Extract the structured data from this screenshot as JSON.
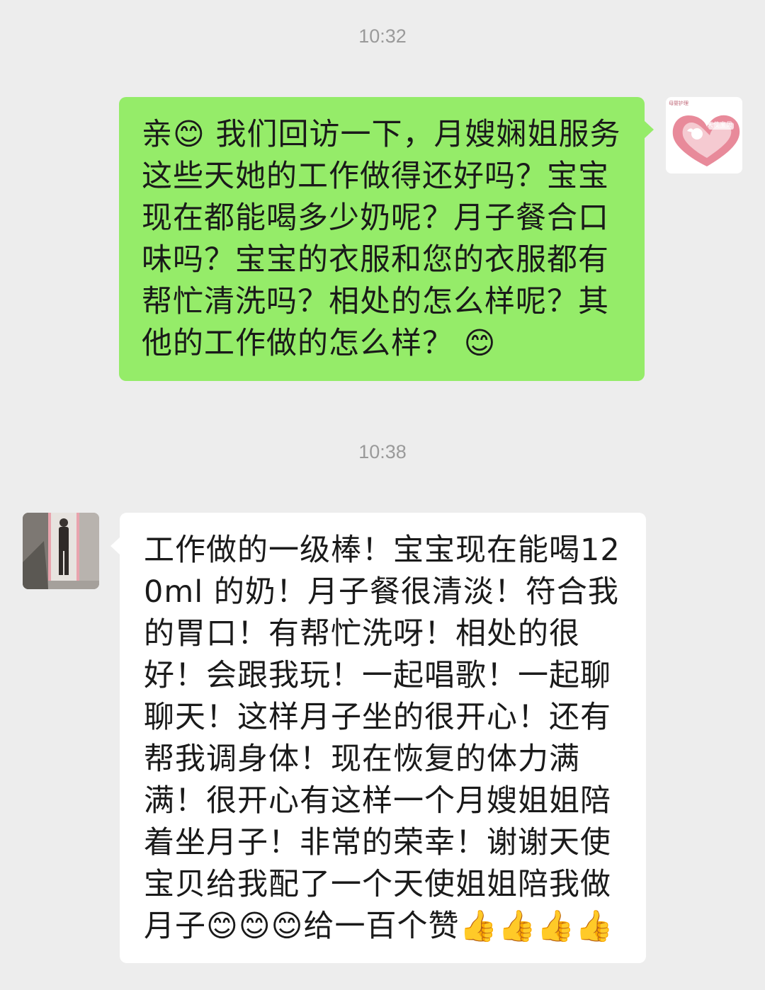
{
  "chat": {
    "timestamp_1": "10:32",
    "timestamp_2": "10:38",
    "messages": [
      {
        "sender": "self",
        "avatar_text": "天使宝贝",
        "avatar_small_text": "母婴护理",
        "text": "亲😊 我们回访一下，月嫂娴姐服务这些天她的工作做得还好吗？宝宝现在都能喝多少奶呢？月子餐合口味吗？宝宝的衣服和您的衣服都有帮忙清洗吗？相处的怎么样呢？其他的工作做的怎么样？ 😊"
      },
      {
        "sender": "other",
        "text": "工作做的一级棒！宝宝现在能喝120ml 的奶！月子餐很清淡！符合我的胃口！有帮忙洗呀！相处的很好！会跟我玩！一起唱歌！一起聊聊天！这样月子坐的很开心！还有帮我调身体！现在恢复的体力满满！很开心有这样一个月嫂姐姐陪着坐月子！非常的荣幸！谢谢天使宝贝给我配了一个天使姐姐陪我做月子😊😊😊给一百个赞👍👍👍👍"
      }
    ]
  },
  "colors": {
    "background": "#ededed",
    "outgoing_bubble": "#95ec69",
    "incoming_bubble": "#ffffff",
    "timestamp_text": "#9a9a9a",
    "brand_pink": "#e88a9a"
  }
}
